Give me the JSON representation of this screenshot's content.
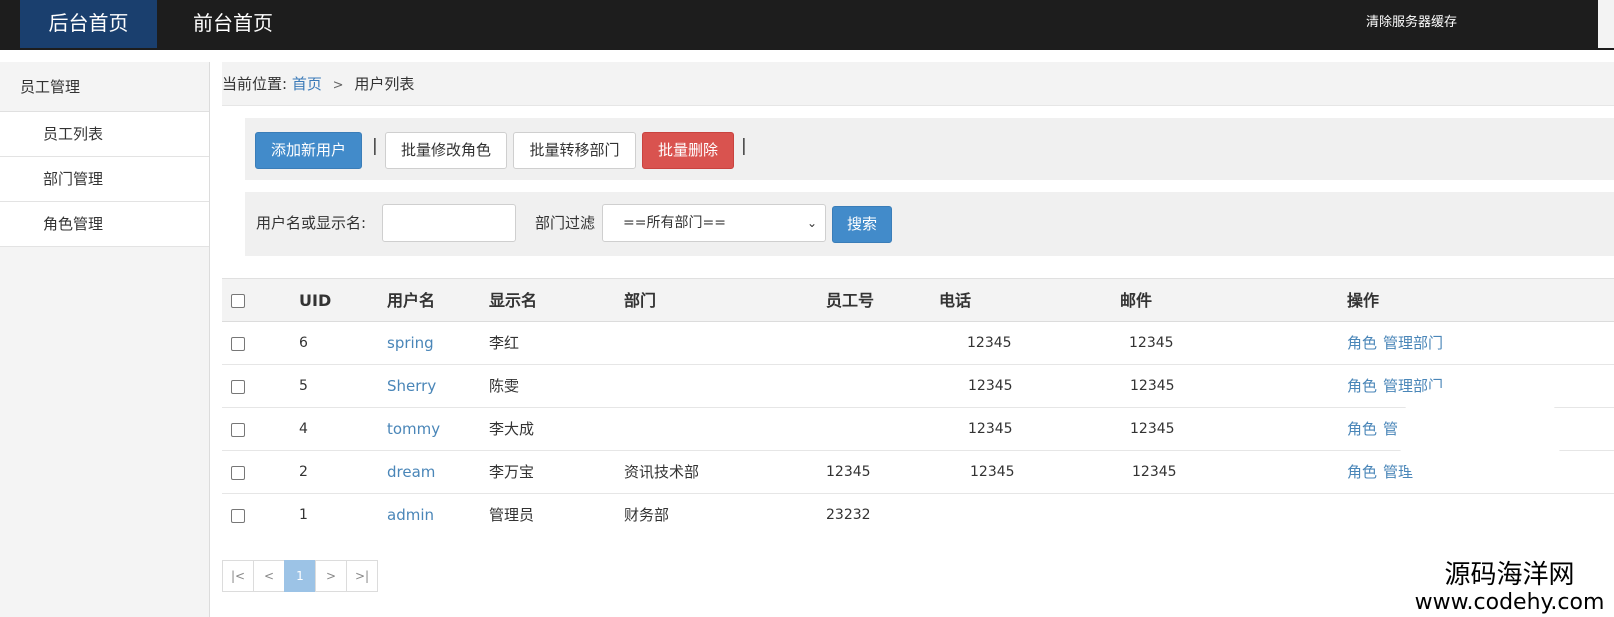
{
  "topbar": {
    "nav": [
      "后台首页",
      "前台首页"
    ],
    "right_link": "清除服务器缓存"
  },
  "sidebar": {
    "group": "员工管理",
    "items": [
      "员工列表",
      "部门管理",
      "角色管理"
    ]
  },
  "breadcrumb": {
    "prefix": "当前位置:",
    "home": "首页",
    "separator": ">",
    "current": "用户列表"
  },
  "toolbar": {
    "add": "添加新用户",
    "pipe": "|",
    "change_role": "批量修改角色",
    "transfer_dept": "批量转移部门",
    "delete": "批量删除"
  },
  "filter": {
    "name_label": "用户名或显示名:",
    "name_value": "",
    "dept_label": "部门过滤",
    "dept_selected": "==所有部门==",
    "search": "搜索"
  },
  "table": {
    "headers": [
      "UID",
      "用户名",
      "显示名",
      "部门",
      "员工号",
      "电话",
      "邮件",
      "操作"
    ],
    "rows": [
      {
        "uid": "6",
        "username": "spring",
        "display": "李红",
        "dept": "",
        "empno": "",
        "phone": "12345",
        "email": "12345",
        "op_role": "角色",
        "op_dept": "管理部门"
      },
      {
        "uid": "5",
        "username": "Sherry",
        "display": "陈雯",
        "dept": "",
        "empno": "",
        "phone": "12345",
        "email": "12345",
        "op_role": "角色",
        "op_dept": "管理部门"
      },
      {
        "uid": "4",
        "username": "tommy",
        "display": "李大成",
        "dept": "",
        "empno": "",
        "phone": "12345",
        "email": "12345",
        "op_role": "角色",
        "op_dept": "管"
      },
      {
        "uid": "2",
        "username": "dream",
        "display": "李万宝",
        "dept": "资讯技术部",
        "empno": "12345",
        "phone": "12345",
        "email": "12345",
        "op_role": "角色",
        "op_dept": "管理"
      },
      {
        "uid": "1",
        "username": "admin",
        "display": "管理员",
        "dept": "财务部",
        "empno": "23232",
        "phone": "",
        "email": "",
        "op_role": "",
        "op_dept": ""
      }
    ]
  },
  "pager": [
    "|<",
    "<",
    "1",
    ">",
    ">|"
  ],
  "watermark": {
    "line1": "源码海洋网",
    "line2": "www.codehy.com"
  }
}
